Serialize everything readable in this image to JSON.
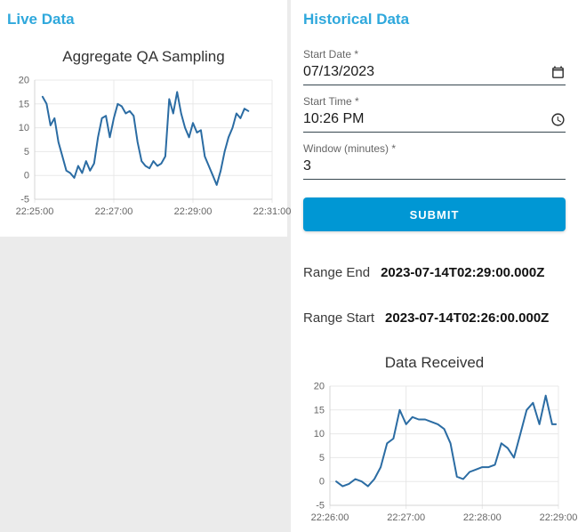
{
  "live_panel": {
    "title": "Live Data"
  },
  "historical_panel": {
    "title": "Historical Data",
    "form": {
      "start_date": {
        "label": "Start Date *",
        "value": "07/13/2023",
        "icon": "calendar-icon"
      },
      "start_time": {
        "label": "Start Time *",
        "value": "10:26 PM",
        "icon": "clock-icon"
      },
      "window": {
        "label": "Window (minutes) *",
        "value": "3"
      },
      "submit_label": "SUBMIT"
    },
    "results": {
      "range_end_label": "Range End",
      "range_end_value": "2023-07-14T02:29:00.000Z",
      "range_start_label": "Range Start",
      "range_start_value": "2023-07-14T02:26:00.000Z"
    }
  },
  "colors": {
    "heading_accent": "#2fa8dc",
    "submit_button": "#0097d4",
    "chart_line": "#2b6ca3",
    "grid": "#e8e8e8",
    "page_background": "#ebebeb"
  },
  "chart_data": [
    {
      "type": "line",
      "title": "Aggregate QA Sampling",
      "xlabel": "",
      "ylabel": "",
      "xlim": [
        0,
        360
      ],
      "ylim": [
        -5,
        20
      ],
      "yticks": [
        -5,
        0,
        5,
        10,
        15,
        20
      ],
      "xticks": [
        {
          "pos": 0,
          "label": "22:25:00"
        },
        {
          "pos": 120,
          "label": "22:27:00"
        },
        {
          "pos": 240,
          "label": "22:29:00"
        },
        {
          "pos": 360,
          "label": "22:31:00"
        }
      ],
      "x_unit": "seconds after 22:25:00",
      "grid": true,
      "legend": "none",
      "line_color": "#2b6ca3",
      "x": [
        12,
        18,
        24,
        30,
        36,
        42,
        48,
        54,
        60,
        66,
        72,
        78,
        84,
        90,
        96,
        102,
        108,
        114,
        120,
        126,
        132,
        138,
        144,
        150,
        156,
        162,
        168,
        174,
        180,
        186,
        192,
        198,
        204,
        210,
        216,
        222,
        228,
        234,
        240,
        246,
        252,
        258,
        264,
        270,
        276,
        282,
        288,
        294,
        300,
        306,
        312,
        318,
        324
      ],
      "values": [
        16.5,
        15,
        10.5,
        12,
        7,
        4,
        1,
        0.5,
        -0.5,
        2,
        0.5,
        3,
        1,
        2.5,
        8,
        12,
        12.5,
        8,
        12,
        15,
        14.5,
        13,
        13.5,
        12.5,
        7,
        3,
        2,
        1.5,
        3,
        2,
        2.5,
        4,
        16,
        13,
        17.5,
        13,
        10,
        8,
        11,
        9,
        9.5,
        4,
        2,
        0,
        -2,
        1,
        5,
        8,
        10,
        13,
        12,
        14,
        13.5
      ]
    },
    {
      "type": "line",
      "title": "Data Received",
      "xlabel": "",
      "ylabel": "",
      "xlim": [
        0,
        180
      ],
      "ylim": [
        -5,
        20
      ],
      "yticks": [
        -5,
        0,
        5,
        10,
        15,
        20
      ],
      "xticks": [
        {
          "pos": 0,
          "label": "22:26:00"
        },
        {
          "pos": 60,
          "label": "22:27:00"
        },
        {
          "pos": 120,
          "label": "22:28:00"
        },
        {
          "pos": 180,
          "label": "22:29:00"
        }
      ],
      "x_unit": "seconds after 22:26:00",
      "grid": true,
      "legend": "none",
      "line_color": "#2b6ca3",
      "x": [
        5,
        10,
        15,
        20,
        25,
        30,
        35,
        40,
        45,
        50,
        55,
        60,
        65,
        70,
        75,
        80,
        85,
        90,
        95,
        100,
        105,
        110,
        115,
        120,
        125,
        130,
        135,
        140,
        145,
        150,
        155,
        160,
        165,
        170,
        175,
        178
      ],
      "values": [
        0,
        -1,
        -0.5,
        0.5,
        0,
        -1,
        0.5,
        3,
        8,
        9,
        15,
        12,
        13.5,
        13,
        13,
        12.5,
        12,
        11,
        8,
        1,
        0.5,
        2,
        2.5,
        3,
        3,
        3.5,
        8,
        7,
        5,
        10,
        15,
        16.5,
        12,
        18,
        12,
        12
      ]
    }
  ]
}
